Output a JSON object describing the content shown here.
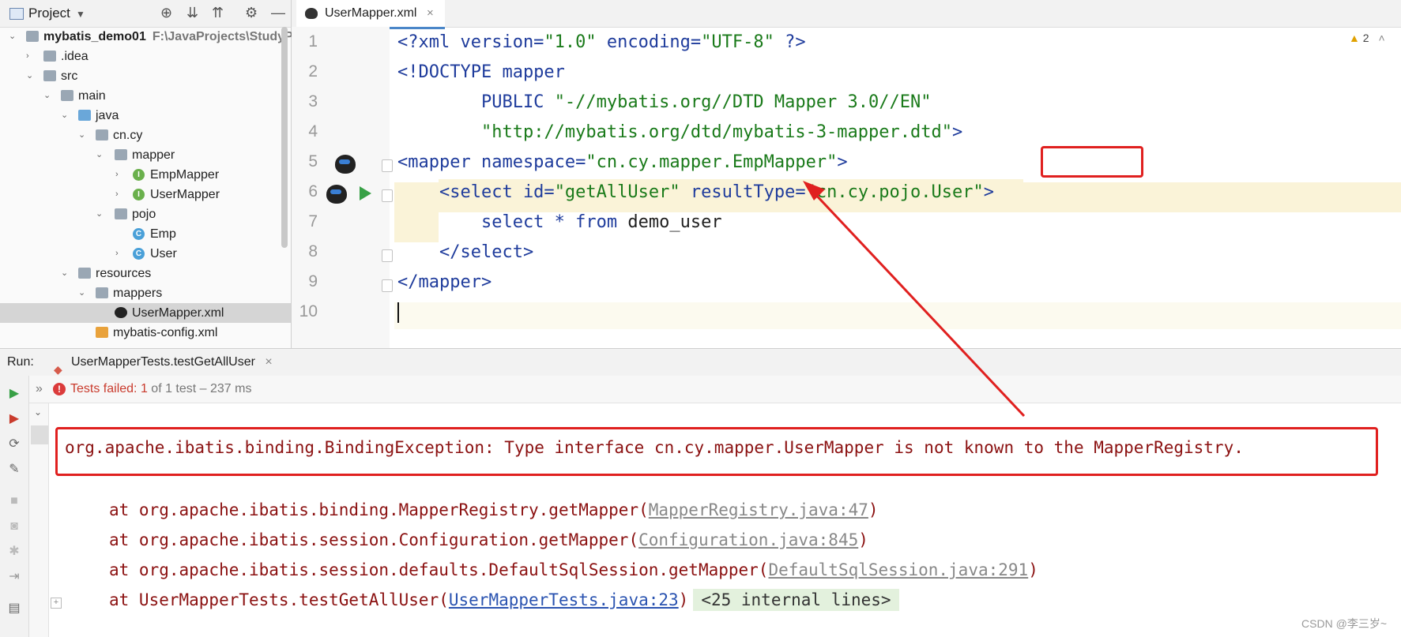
{
  "project_panel": {
    "title": "Project",
    "tree": [
      {
        "label": "mybatis_demo01",
        "path": "F:\\JavaProjects\\StudyPro",
        "depth": 0,
        "expanded": true,
        "icon": "module-folder-icon"
      },
      {
        "label": ".idea",
        "depth": 1,
        "expanded": false,
        "icon": "folder-icon"
      },
      {
        "label": "src",
        "depth": 1,
        "expanded": true,
        "icon": "folder-icon"
      },
      {
        "label": "main",
        "depth": 2,
        "expanded": true,
        "icon": "folder-icon"
      },
      {
        "label": "java",
        "depth": 3,
        "expanded": true,
        "icon": "source-folder-icon"
      },
      {
        "label": "cn.cy",
        "depth": 4,
        "expanded": true,
        "icon": "package-icon"
      },
      {
        "label": "mapper",
        "depth": 5,
        "expanded": true,
        "icon": "package-icon"
      },
      {
        "label": "EmpMapper",
        "depth": 6,
        "expanded": false,
        "icon": "interface-icon"
      },
      {
        "label": "UserMapper",
        "depth": 6,
        "expanded": false,
        "icon": "interface-icon"
      },
      {
        "label": "pojo",
        "depth": 5,
        "expanded": true,
        "icon": "package-icon"
      },
      {
        "label": "Emp",
        "depth": 6,
        "icon": "class-icon"
      },
      {
        "label": "User",
        "depth": 6,
        "expanded": false,
        "icon": "class-icon"
      },
      {
        "label": "resources",
        "depth": 3,
        "expanded": true,
        "icon": "resources-folder-icon"
      },
      {
        "label": "mappers",
        "depth": 4,
        "expanded": true,
        "icon": "folder-icon"
      },
      {
        "label": "UserMapper.xml",
        "depth": 5,
        "icon": "mybatis-xml-icon",
        "selected": true
      },
      {
        "label": "mybatis-config.xml",
        "depth": 4,
        "icon": "xml-file-icon"
      }
    ]
  },
  "editor": {
    "tab_label": "UserMapper.xml",
    "tab_close": "×",
    "warnings": "2",
    "line_numbers": [
      "1",
      "2",
      "3",
      "4",
      "5",
      "6",
      "7",
      "8",
      "9",
      "10"
    ],
    "lines": {
      "l1": {
        "a": "<?xml version=",
        "b": "\"1.0\"",
        "c": " encoding=",
        "d": "\"UTF-8\"",
        "e": " ?>"
      },
      "l2": {
        "a": "<!DOCTYPE mapper"
      },
      "l3": {
        "a": "        PUBLIC ",
        "b": "\"-//mybatis.org//DTD Mapper 3.0//EN\""
      },
      "l4": {
        "a": "        ",
        "b": "\"http://mybatis.org/dtd/mybatis-3-mapper.dtd\"",
        "c": ">"
      },
      "l5": {
        "a": "<mapper namespace=",
        "b": "\"cn.cy.mapper.",
        "c": "EmpMapper",
        "d": "\"",
        "e": ">"
      },
      "l6": {
        "a": "    <select id=",
        "b": "\"getAllUser\"",
        "c": " resultType=",
        "d": "\"cn.cy.pojo.User\"",
        "e": ">"
      },
      "l7": {
        "a": "        select * from ",
        "b": "demo_user"
      },
      "l8": {
        "a": "    </select>"
      },
      "l9": {
        "a": "</mapper>"
      },
      "l10": {
        "a": ""
      }
    }
  },
  "run_panel": {
    "label": "Run:",
    "tab_label": "UserMapperTests.testGetAllUser",
    "tab_close": "×",
    "status_prefix": "Tests failed: ",
    "status_count": "1",
    "status_suffix": " of 1 test – 237 ms",
    "error_message": "org.apache.ibatis.binding.BindingException: Type interface cn.cy.mapper.UserMapper is not known to the MapperRegistry.",
    "stack": [
      {
        "prefix": "at org.apache.ibatis.binding.MapperRegistry.getMapper(",
        "link": "MapperRegistry.java:47",
        "suffix": ")"
      },
      {
        "prefix": "at org.apache.ibatis.session.Configuration.getMapper(",
        "link": "Configuration.java:845",
        "suffix": ")"
      },
      {
        "prefix": "at org.apache.ibatis.session.defaults.DefaultSqlSession.getMapper(",
        "link": "DefaultSqlSession.java:291",
        "suffix": ")"
      },
      {
        "prefix": "at UserMapperTests.testGetAllUser(",
        "link": "UserMapperTests.java:23",
        "suffix": ")",
        "internal": "<25 internal lines>"
      }
    ]
  },
  "watermark": "CSDN @李三岁~",
  "colors": {
    "annotation_red": "#e0201f",
    "error_text": "#8b1111",
    "xml_tag": "#1f3c9c",
    "xml_string": "#1a7a1a",
    "highlight": "#faf3d8"
  }
}
